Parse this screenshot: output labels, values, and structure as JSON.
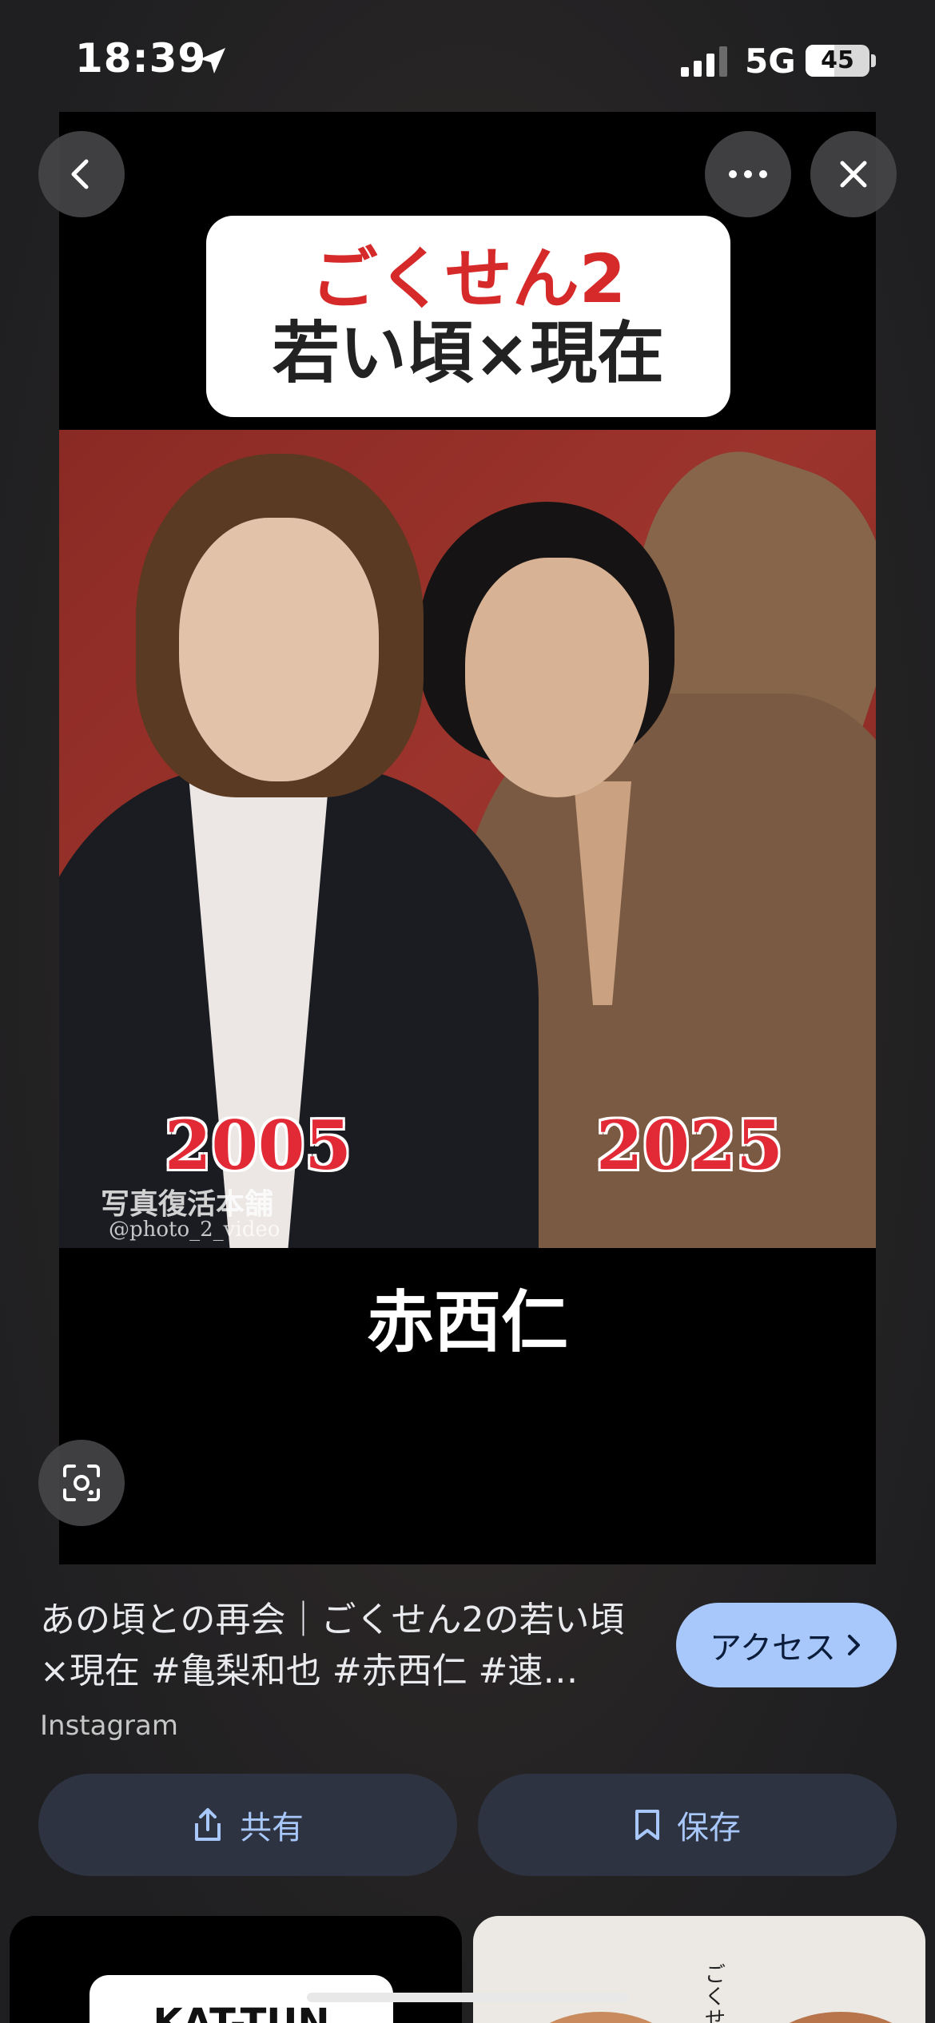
{
  "status_bar": {
    "time": "18:39",
    "network": "5G",
    "battery": "45",
    "battery_level_percent": 45
  },
  "image": {
    "title_line1": "ごくせん2",
    "title_line2": "若い頃×現在",
    "year_left": "2005",
    "year_right": "2025",
    "watermark_line1": "写真復活本舗",
    "watermark_line2": "@photo_2_video",
    "name": "赤西仁"
  },
  "buttons": {
    "back": "back-icon",
    "more": "more-icon",
    "close": "close-icon",
    "lens": "lens-icon"
  },
  "result": {
    "caption": "あの頃との再会｜ごくせん2の若い頃×現在 #亀梨和也 #赤西仁 #速…",
    "source": "Instagram",
    "visit_label": "アクセス"
  },
  "actions": {
    "share_label": "共有",
    "save_label": "保存"
  },
  "related": {
    "left_card_text": "KAT-TUN",
    "right_text": "ごくせん悪ガキ"
  },
  "colors": {
    "accent": "#a8c7fa",
    "background": "#202124",
    "button_bg": "#2d3340"
  }
}
